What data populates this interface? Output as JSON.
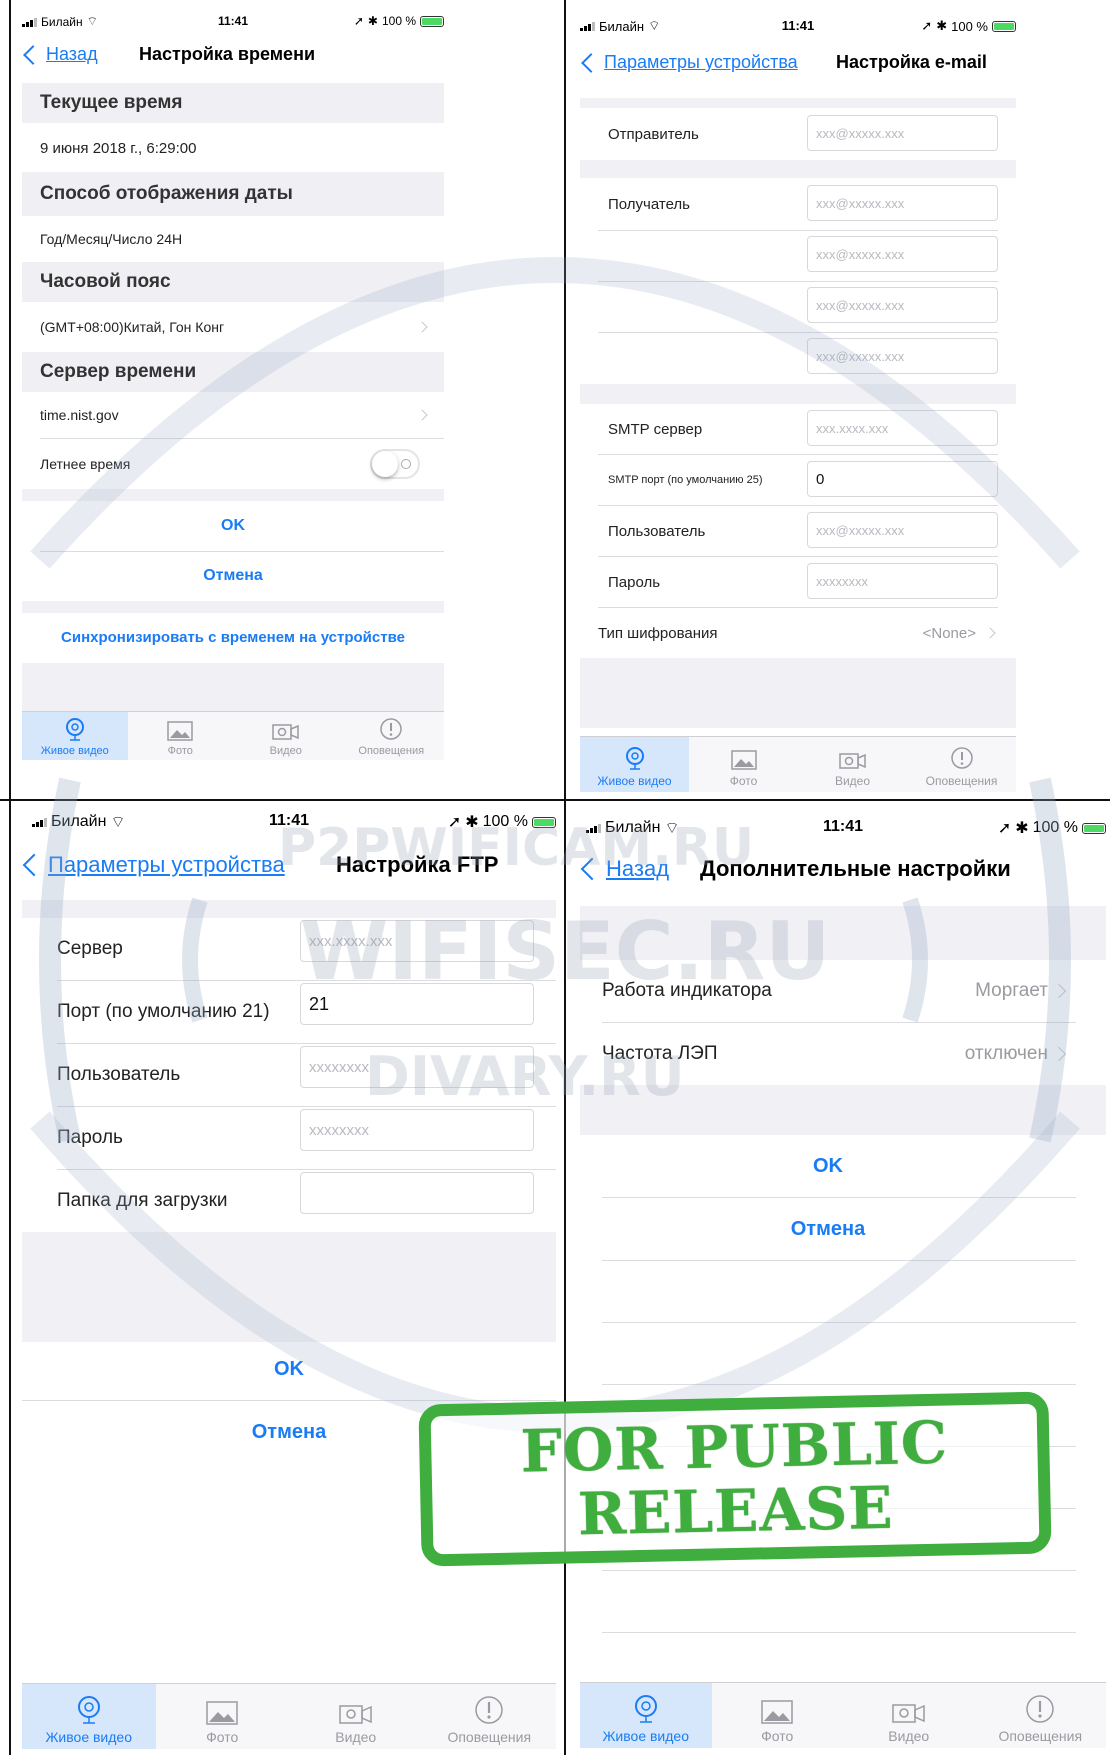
{
  "status": {
    "carrier": "Билайн",
    "time": "11:41",
    "battery": "100 %"
  },
  "time_settings": {
    "back_label": "Назад",
    "title": "Настройка времени",
    "current_time_header": "Текущее время",
    "current_time_value": "9 июня 2018 г., 6:29:00",
    "date_format_header": "Способ отображения даты",
    "date_format_value": "Год/Месяц/Число 24H",
    "timezone_header": "Часовой пояс",
    "timezone_value": "(GMT+08:00)Китай, Гон Конг",
    "server_header": "Сервер времени",
    "server_value": "time.nist.gov",
    "dst_label": "Летнее время",
    "ok_label": "OK",
    "cancel_label": "Отмена",
    "sync_label": "Синхронизировать с временем на устройстве"
  },
  "email_settings": {
    "back_label": "Параметры устройства",
    "title": "Настройка e-mail",
    "sender_label": "Отправитель",
    "sender_placeholder": "xxx@xxxxx.xxx",
    "recipient_label": "Получатель",
    "recipient_placeholders": [
      "xxx@xxxxx.xxx",
      "xxx@xxxxx.xxx",
      "xxx@xxxxx.xxx",
      "xxx@xxxxx.xxx"
    ],
    "smtp_server_label": "SMTP сервер",
    "smtp_server_placeholder": "xxx.xxxx.xxx",
    "smtp_port_label": "SMTP порт (по умолчанию 25)",
    "smtp_port_value": "0",
    "user_label": "Пользователь",
    "user_placeholder": "xxx@xxxxx.xxx",
    "password_label": "Пароль",
    "password_placeholder": "xxxxxxxx",
    "encryption_label": "Тип шифрования",
    "encryption_value": "<None>"
  },
  "ftp_settings": {
    "back_label": "Параметры устройства",
    "title": "Настройка FTP",
    "server_label": "Сервер",
    "server_placeholder": "xxx.xxxx.xxx",
    "port_label": "Порт (по умолчанию 21)",
    "port_value": "21",
    "user_label": "Пользователь",
    "user_placeholder": "xxxxxxxx",
    "password_label": "Пароль",
    "password_placeholder": "xxxxxxxx",
    "folder_label": "Папка для загрузки",
    "folder_value": "",
    "ok_label": "OK",
    "cancel_label": "Отмена"
  },
  "advanced_settings": {
    "back_label": "Назад",
    "title": "Дополнительные настройки",
    "indicator_label": "Работа индикатора",
    "indicator_value": "Моргает",
    "powerline_label": "Частота ЛЭП",
    "powerline_value": "отключен",
    "ok_label": "OK",
    "cancel_label": "Отмена"
  },
  "tabs": [
    {
      "label": "Живое видео",
      "icon": "live-video-icon",
      "active": true
    },
    {
      "label": "Фото",
      "icon": "photo-icon",
      "active": false
    },
    {
      "label": "Видео",
      "icon": "video-icon",
      "active": false
    },
    {
      "label": "Оповещения",
      "icon": "alert-icon",
      "active": false
    }
  ],
  "watermarks": [
    "P2PWIFICAM.RU",
    "WIFISEC.RU",
    "DIVARY.RU"
  ],
  "stamp": {
    "line1": "FOR PUBLIC",
    "line2": "RELEASE"
  },
  "colors": {
    "accent": "#1a7cf5",
    "stamp": "#3fae3f",
    "active_tab_bg": "#d6e7fb"
  }
}
